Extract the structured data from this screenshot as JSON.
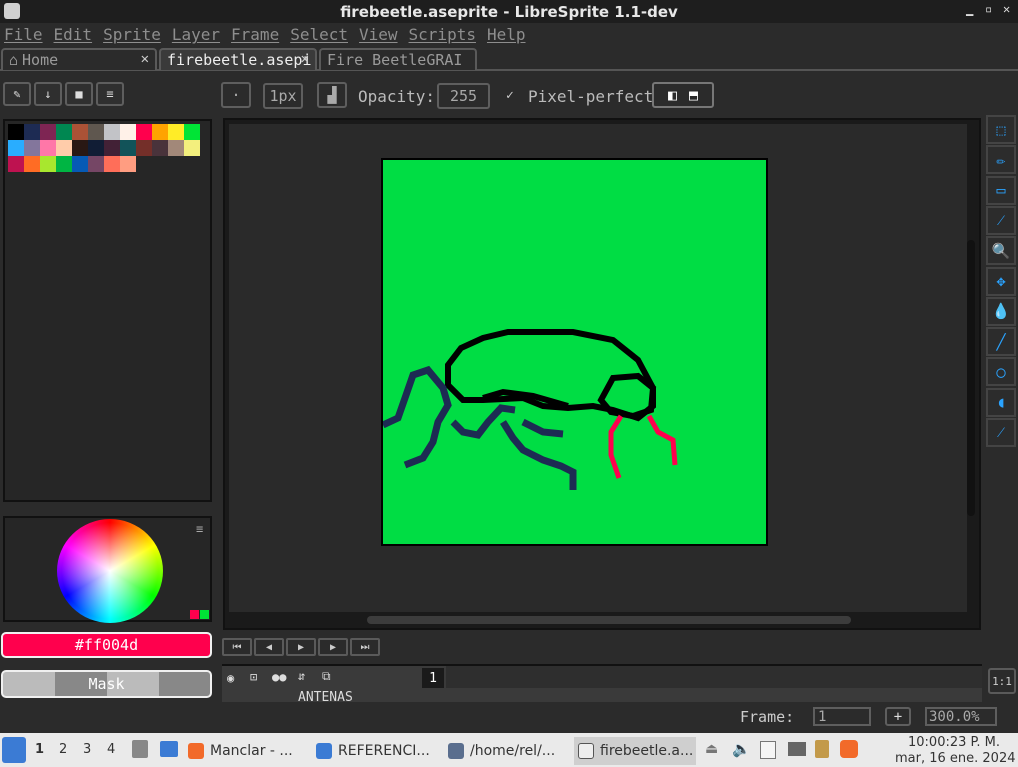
{
  "window": {
    "title": "firebeetle.aseprite - LibreSprite 1.1-dev"
  },
  "menu": [
    "File",
    "Edit",
    "Sprite",
    "Layer",
    "Frame",
    "Select",
    "View",
    "Scripts",
    "Help"
  ],
  "tabs": [
    {
      "label": "Home",
      "close": "✕"
    },
    {
      "label": "firebeetle.asepi",
      "close": "✕",
      "active": true
    },
    {
      "label": "Fire BeetleGRAI",
      "close": ""
    }
  ],
  "context_bar": {
    "brush_size": "1px",
    "opacity_label": "Opacity:",
    "opacity_value": "255",
    "pixel_perfect_check": "✓",
    "pixel_perfect_label": "Pixel-perfect"
  },
  "palette": {
    "colors": [
      "#000000",
      "#1d2b53",
      "#7e2553",
      "#008751",
      "#ab5236",
      "#5f574f",
      "#c2c3c7",
      "#fff1e8",
      "#ff004d",
      "#ffa300",
      "#ffec27",
      "#00e436",
      "#29adff",
      "#83769c",
      "#ff77a8",
      "#ffccaa",
      "#291814",
      "#111d35",
      "#422136",
      "#125359",
      "#742f29",
      "#49333b",
      "#a28879",
      "#f3ef7d",
      "#be1250",
      "#ff6c24",
      "#a8e72e",
      "#00b543",
      "#065ab5",
      "#754665",
      "#ff6e59",
      "#ff9d81"
    ]
  },
  "color": {
    "foreground_hex": "#ff004d",
    "mask_label": "Mask"
  },
  "timeline": {
    "frame_number": "1",
    "layer_name": "ANTENAS"
  },
  "status": {
    "frame_label": "Frame:",
    "frame_value": "1",
    "add_label": "+",
    "zoom_value": "300.0%"
  },
  "taskbar": {
    "workspaces": [
      "1",
      "2",
      "3",
      "4"
    ],
    "tasks": [
      {
        "label": "Manclar - ..."
      },
      {
        "label": "REFERENCI..."
      },
      {
        "label": "/home/rel/..."
      },
      {
        "label": "firebeetle.a..."
      }
    ],
    "clock_time": "10:00:23 P. M.",
    "clock_date": "mar, 16 ene. 2024"
  },
  "icons": {
    "tools": [
      "rectangle-marquee-icon",
      "pencil-icon",
      "eraser-icon",
      "eyedropper-icon",
      "zoom-icon",
      "move-icon",
      "paint-bucket-icon",
      "line-icon",
      "ellipse-icon",
      "blur-icon",
      "spray-icon"
    ]
  }
}
